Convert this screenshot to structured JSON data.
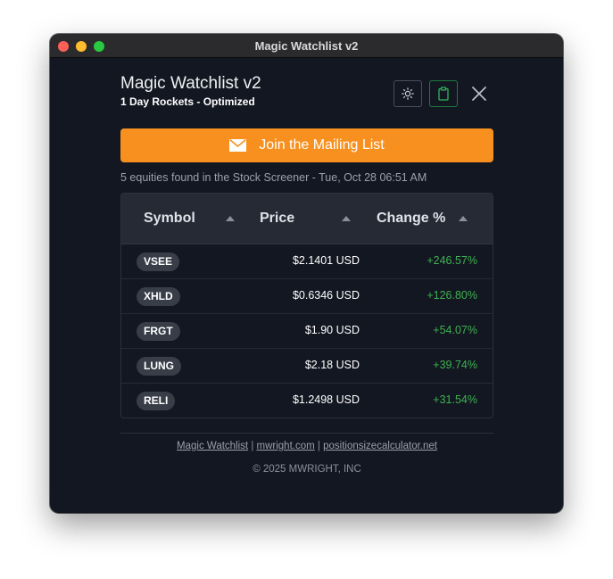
{
  "window": {
    "title": "Magic Watchlist v2"
  },
  "header": {
    "title": "Magic Watchlist v2",
    "subtitle": "1 Day Rockets - Optimized",
    "icons": [
      "sun-icon",
      "clipboard-icon",
      "close-icon"
    ]
  },
  "mailing": {
    "label": "Join the Mailing List",
    "icon": "envelope-icon",
    "color": "#f7901e"
  },
  "status": {
    "text": "5 equities found in the Stock Screener - Tue, Oct 28 06:51 AM"
  },
  "table": {
    "columns": [
      "Symbol",
      "Price",
      "Change %"
    ],
    "rows": [
      {
        "symbol": "VSEE",
        "price": "$2.1401 USD",
        "change": "+246.57%"
      },
      {
        "symbol": "XHLD",
        "price": "$0.6346 USD",
        "change": "+126.80%"
      },
      {
        "symbol": "FRGT",
        "price": "$1.90 USD",
        "change": "+54.07%"
      },
      {
        "symbol": "LUNG",
        "price": "$2.18 USD",
        "change": "+39.74%"
      },
      {
        "symbol": "RELI",
        "price": "$1.2498 USD",
        "change": "+31.54%"
      }
    ]
  },
  "footer": {
    "links": [
      "Magic Watchlist",
      "mwright.com",
      "positionsizecalculator.net"
    ],
    "separator": "|",
    "copyright": "© 2025 MWRIGHT, INC"
  },
  "colors": {
    "background": "#131722",
    "accent": "#f7901e",
    "positive": "#3fb14f"
  }
}
